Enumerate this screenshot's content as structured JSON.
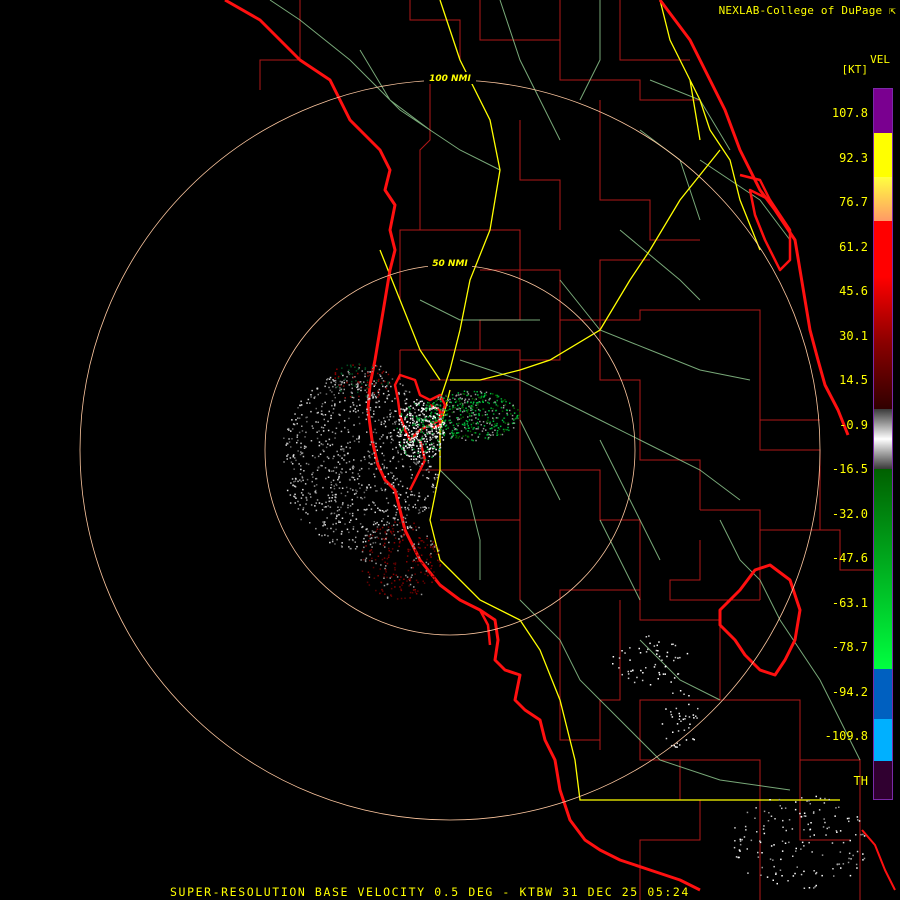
{
  "credit": "NEXLAB-College of DuPage",
  "credit_icon": "cursor-arrow-icon",
  "legend": {
    "product": "VEL",
    "units": "[KT]",
    "labels": [
      "107.8",
      "92.3",
      "76.7",
      "61.2",
      "45.6",
      "30.1",
      "14.5",
      "-0.9",
      "-16.5",
      "-32.0",
      "-47.6",
      "-63.1",
      "-78.7",
      "-94.2",
      "-109.8",
      "TH"
    ],
    "colors": [
      "#7a0090",
      "#ffff00",
      "#ff9966",
      "#ff0000",
      "#8a0000",
      "#ffffff",
      "#00ff40",
      "#006000",
      "#0060c0",
      "#00b0ff",
      "#300030"
    ]
  },
  "range_rings": [
    {
      "label": "100 NMI"
    },
    {
      "label": "50 NMI"
    }
  ],
  "footer": "SUPER-RESOLUTION BASE VELOCITY 0.5 DEG - KTBW 31 DEC 25 05:24",
  "colors": {
    "coast": "#ff1010",
    "county": "#b01818",
    "highway_primary": "#ffff00",
    "highway_secondary": "#a0e0a0",
    "range_ring": "#ffc8a0"
  }
}
